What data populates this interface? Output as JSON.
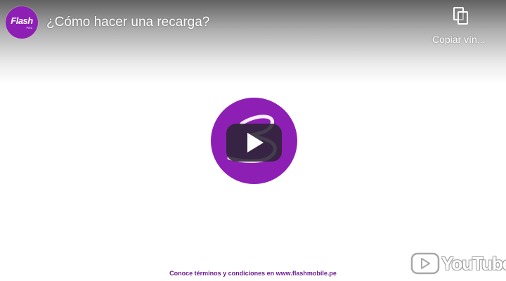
{
  "header": {
    "channel_logo_text": "Flash",
    "channel_logo_sub": "Perú",
    "title": "¿Cómo hacer una recarga?",
    "copy_link_label": "Copiar vín..."
  },
  "player": {
    "play_icon": "play-icon",
    "brand_color": "#8e1fb5"
  },
  "footer": {
    "terms_text": "Conoce términos y condiciones en www.flashmobile.pe",
    "terms_color": "#6b1a8c",
    "watermark": "YouTube"
  }
}
